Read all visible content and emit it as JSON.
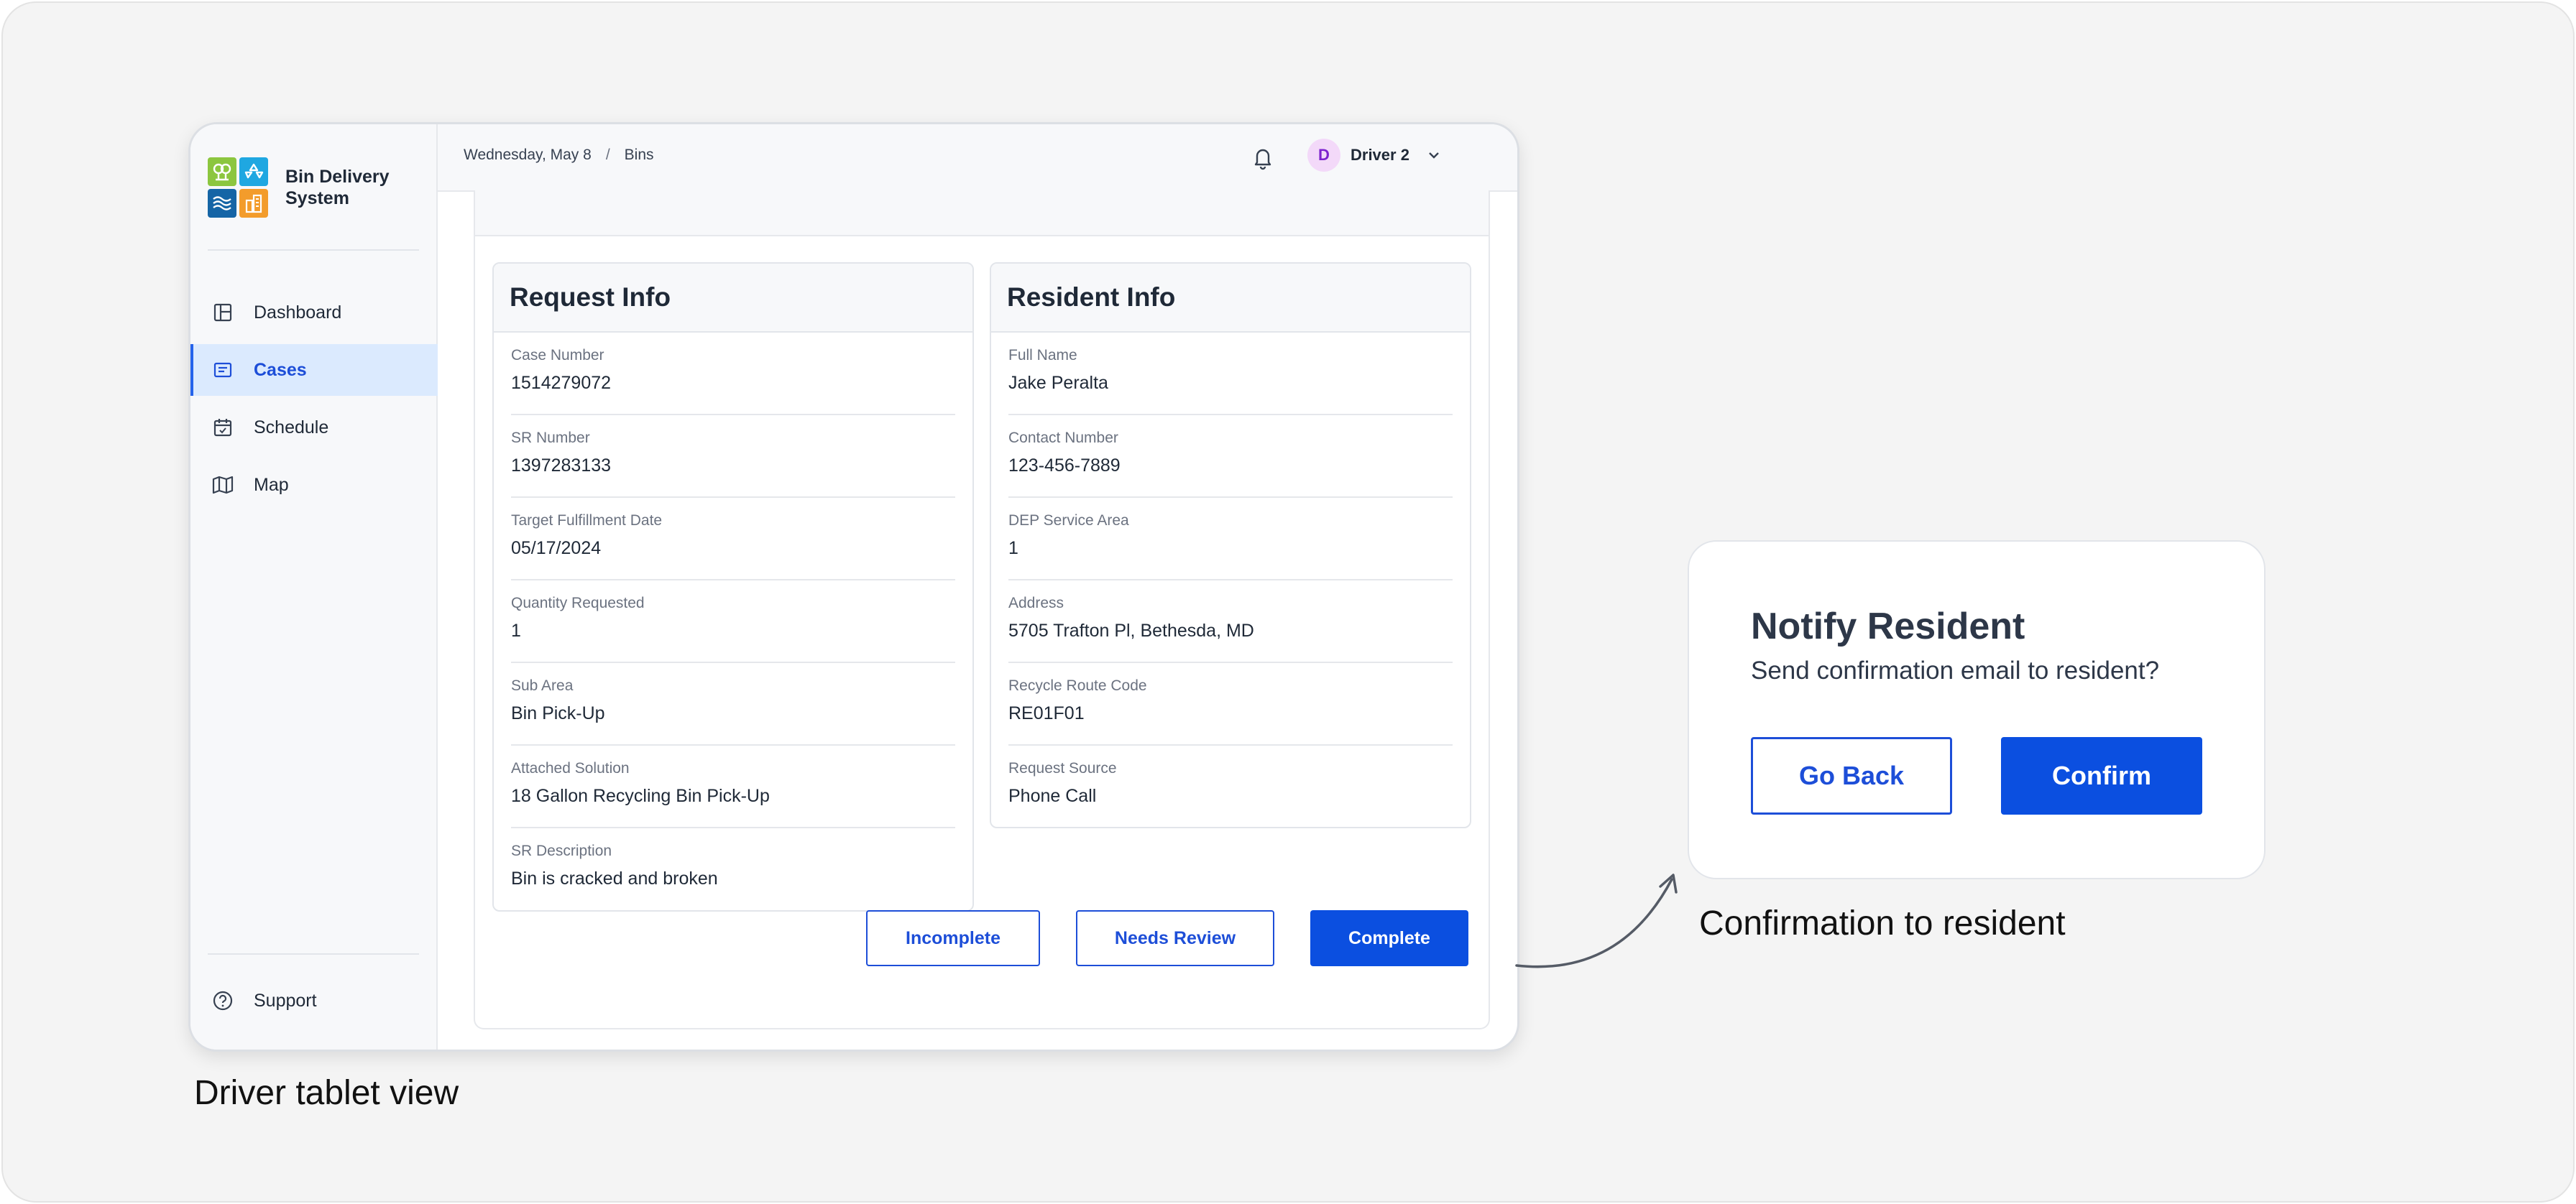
{
  "app": {
    "brand_title": "Bin Delivery System",
    "logo_icons": [
      "tree-icon",
      "recycle-icon",
      "water-icon",
      "building-icon"
    ]
  },
  "sidebar": {
    "items": [
      {
        "label": "Dashboard",
        "icon": "dashboard-icon",
        "active": false
      },
      {
        "label": "Cases",
        "icon": "cases-icon",
        "active": true
      },
      {
        "label": "Schedule",
        "icon": "calendar-icon",
        "active": false
      },
      {
        "label": "Map",
        "icon": "map-icon",
        "active": false
      }
    ],
    "support_label": "Support"
  },
  "topbar": {
    "date": "Wednesday, May 8",
    "separator": "/",
    "section": "Bins",
    "user_initial": "D",
    "user_name": "Driver 2"
  },
  "request_info": {
    "title": "Request Info",
    "fields": [
      {
        "label": "Case Number",
        "value": "1514279072"
      },
      {
        "label": "SR Number",
        "value": "1397283133"
      },
      {
        "label": "Target Fulfillment Date",
        "value": "05/17/2024"
      },
      {
        "label": "Quantity Requested",
        "value": "1"
      },
      {
        "label": "Sub Area",
        "value": "Bin Pick-Up"
      },
      {
        "label": "Attached Solution",
        "value": "18 Gallon Recycling Bin Pick-Up"
      },
      {
        "label": "SR Description",
        "value": "Bin is cracked and broken"
      }
    ]
  },
  "resident_info": {
    "title": "Resident Info",
    "fields": [
      {
        "label": "Full Name",
        "value": "Jake Peralta"
      },
      {
        "label": "Contact Number",
        "value": "123-456-7889"
      },
      {
        "label": "DEP Service Area",
        "value": "1"
      },
      {
        "label": "Address",
        "value": "5705 Trafton Pl, Bethesda, MD"
      },
      {
        "label": "Recycle Route Code",
        "value": "RE01F01"
      },
      {
        "label": "Request Source",
        "value": "Phone Call"
      }
    ]
  },
  "actions": {
    "incomplete": "Incomplete",
    "needs_review": "Needs Review",
    "complete": "Complete"
  },
  "captions": {
    "tablet": "Driver tablet view",
    "dialog": "Confirmation to resident"
  },
  "dialog": {
    "title": "Notify Resident",
    "message": "Send confirmation email to resident?",
    "go_back": "Go Back",
    "confirm": "Confirm"
  },
  "colors": {
    "primary": "#0b4fe0",
    "active_nav_bg": "#dbeafe",
    "text_dark": "#1f2937",
    "label_gray": "#6b7280"
  }
}
